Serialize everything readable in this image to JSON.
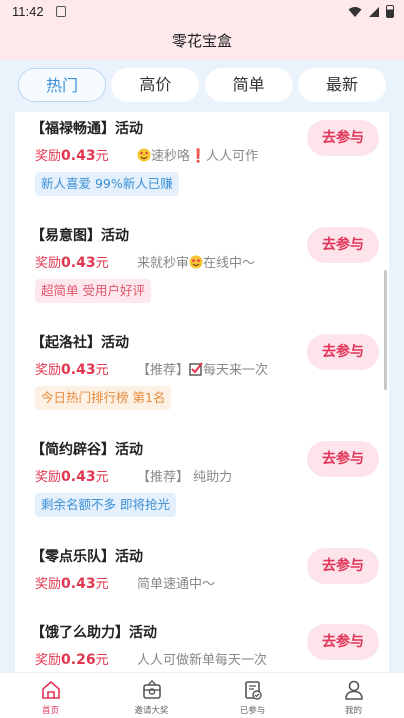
{
  "status_bar": {
    "time": "11:42"
  },
  "header": {
    "title": "零花宝盒"
  },
  "tabs": [
    {
      "label": "热门",
      "active": true
    },
    {
      "label": "高价",
      "active": false
    },
    {
      "label": "简单",
      "active": false
    },
    {
      "label": "最新",
      "active": false
    }
  ],
  "tasks": [
    {
      "name": "【福禄畅通】活动",
      "reward_prefix": "奖励",
      "reward_amount": "0.43",
      "reward_unit": "元",
      "desc_before": "",
      "desc_after": "速秒咯❗人人可作",
      "emoji": "heart-eyes",
      "tag": "新人喜爱  99%新人已赚",
      "tag_color": "blue",
      "button": "去参与"
    },
    {
      "name": "【易意图】活动",
      "reward_prefix": "奖励",
      "reward_amount": "0.43",
      "reward_unit": "元",
      "desc_before": "来就秒审",
      "desc_after": "在线中～",
      "emoji": "star-eyes",
      "tag": "超简单  受用户好评",
      "tag_color": "pink",
      "button": "去参与"
    },
    {
      "name": "【起洛社】活动",
      "reward_prefix": "奖励",
      "reward_amount": "0.43",
      "reward_unit": "元",
      "desc_before": "【推荐】",
      "desc_after": "每天来一次",
      "emoji": "check-box",
      "tag": "今日热门排行榜 第1名",
      "tag_color": "orange",
      "button": "去参与"
    },
    {
      "name": "【简约辟谷】活动",
      "reward_prefix": "奖励",
      "reward_amount": "0.43",
      "reward_unit": "元",
      "desc_before": "【推荐】  纯助力",
      "desc_after": "",
      "emoji": "",
      "tag": "剩余名额不多  即将抢光",
      "tag_color": "blue",
      "button": "去参与"
    },
    {
      "name": "【零点乐队】活动",
      "reward_prefix": "奖励",
      "reward_amount": "0.43",
      "reward_unit": "元",
      "desc_before": "简单速通中～",
      "desc_after": "",
      "emoji": "",
      "tag": "",
      "tag_color": "",
      "button": "去参与"
    },
    {
      "name": "【饿了么助力】活动",
      "reward_prefix": "奖励",
      "reward_amount": "0.26",
      "reward_unit": "元",
      "desc_before": "人人可做新单每天一次",
      "desc_after": "",
      "emoji": "",
      "tag": "",
      "tag_color": "",
      "button": "去参与"
    }
  ],
  "bottom_nav": [
    {
      "label": "首页",
      "icon": "home-icon",
      "active": true
    },
    {
      "label": "邀请大奖",
      "icon": "gift-icon",
      "active": false
    },
    {
      "label": "已参与",
      "icon": "clipboard-check-icon",
      "active": false
    },
    {
      "label": "我的",
      "icon": "user-icon",
      "active": false
    }
  ],
  "colors": {
    "accent": "#e2355a",
    "tab_active": "#3c8fd6",
    "header_bg": "#fde8ec",
    "page_bg": "#eaf3fb"
  }
}
